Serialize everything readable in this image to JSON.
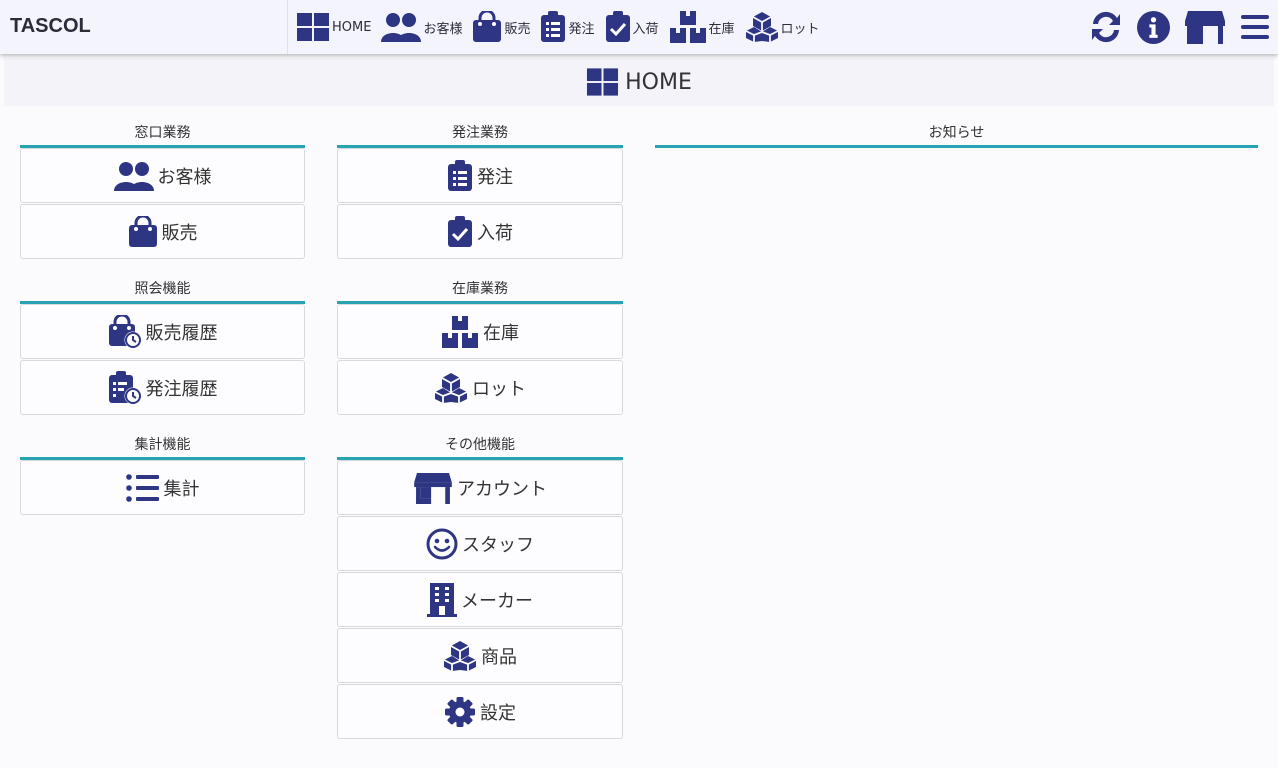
{
  "app": {
    "title": "TASCOL"
  },
  "nav": [
    {
      "label": "HOME",
      "icon": "grid-icon"
    },
    {
      "label": "お客様",
      "icon": "users-icon"
    },
    {
      "label": "販売",
      "icon": "bag-icon"
    },
    {
      "label": "発注",
      "icon": "clipboard-list-icon"
    },
    {
      "label": "入荷",
      "icon": "clipboard-check-icon"
    },
    {
      "label": "在庫",
      "icon": "boxes-icon"
    },
    {
      "label": "ロット",
      "icon": "cubes-icon"
    }
  ],
  "tools": [
    "refresh-icon",
    "info-icon",
    "store-icon",
    "menu-icon"
  ],
  "page": {
    "title": "HOME",
    "icon": "grid-icon"
  },
  "sections": {
    "counter": {
      "title": "窓口業務",
      "items": [
        {
          "label": "お客様",
          "icon": "users-icon"
        },
        {
          "label": "販売",
          "icon": "bag-icon"
        }
      ]
    },
    "inquiry": {
      "title": "照会機能",
      "items": [
        {
          "label": "販売履歴",
          "icon": "bag-history-icon"
        },
        {
          "label": "発注履歴",
          "icon": "clipboard-history-icon"
        }
      ]
    },
    "totals": {
      "title": "集計機能",
      "items": [
        {
          "label": "集計",
          "icon": "list-icon"
        }
      ]
    },
    "ordering": {
      "title": "発注業務",
      "items": [
        {
          "label": "発注",
          "icon": "clipboard-list-icon"
        },
        {
          "label": "入荷",
          "icon": "clipboard-check-icon"
        }
      ]
    },
    "stock": {
      "title": "在庫業務",
      "items": [
        {
          "label": "在庫",
          "icon": "boxes-icon"
        },
        {
          "label": "ロット",
          "icon": "cubes-icon"
        }
      ]
    },
    "other": {
      "title": "その他機能",
      "items": [
        {
          "label": "アカウント",
          "icon": "store-icon"
        },
        {
          "label": "スタッフ",
          "icon": "smile-icon"
        },
        {
          "label": "メーカー",
          "icon": "building-icon"
        },
        {
          "label": "商品",
          "icon": "cubes-icon"
        },
        {
          "label": "設定",
          "icon": "gear-icon"
        }
      ]
    },
    "news": {
      "title": "お知らせ"
    }
  },
  "colors": {
    "accent": "#27a3b1",
    "icon": "#2e3583"
  }
}
